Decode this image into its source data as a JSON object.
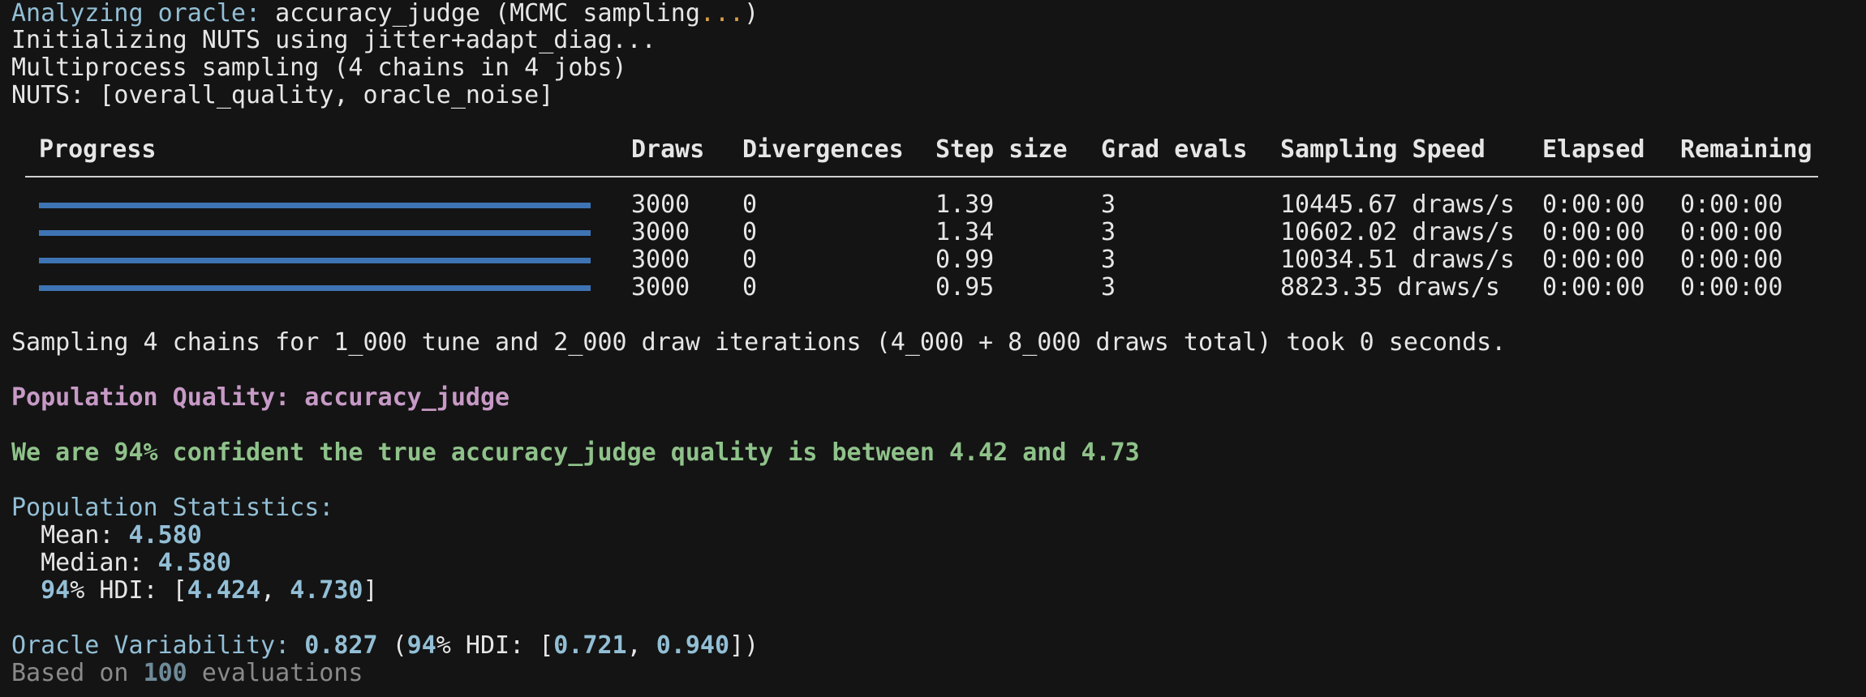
{
  "header": {
    "analyzing_label": "Analyzing oracle:",
    "oracle_name": "accuracy_judge",
    "method_open": "(MCMC sampling",
    "ellipsis": "...",
    "method_close": ")",
    "init_line": "Initializing NUTS using jitter+adapt_diag...",
    "multiprocess_line": "Multiprocess sampling (4 chains in 4 jobs)",
    "nuts_line": "NUTS: [overall_quality, oracle_noise]"
  },
  "table": {
    "columns": [
      "Progress",
      "Draws",
      "Divergences",
      "Step size",
      "Grad evals",
      "Sampling Speed",
      "Elapsed",
      "Remaining"
    ],
    "rows": [
      {
        "progress": 1.0,
        "draws": "3000",
        "divergences": "0",
        "step_size": "1.39",
        "grad_evals": "3",
        "speed": "10445.67 draws/s",
        "elapsed": "0:00:00",
        "remaining": "0:00:00"
      },
      {
        "progress": 1.0,
        "draws": "3000",
        "divergences": "0",
        "step_size": "1.34",
        "grad_evals": "3",
        "speed": "10602.02 draws/s",
        "elapsed": "0:00:00",
        "remaining": "0:00:00"
      },
      {
        "progress": 1.0,
        "draws": "3000",
        "divergences": "0",
        "step_size": "0.99",
        "grad_evals": "3",
        "speed": "10034.51 draws/s",
        "elapsed": "0:00:00",
        "remaining": "0:00:00"
      },
      {
        "progress": 1.0,
        "draws": "3000",
        "divergences": "0",
        "step_size": "0.95",
        "grad_evals": "3",
        "speed": "8823.35 draws/s",
        "elapsed": "0:00:00",
        "remaining": "0:00:00"
      }
    ],
    "bar_color": "#3e74b4"
  },
  "summary_line": "Sampling 4 chains for 1_000 tune and 2_000 draw iterations (4_000 + 8_000 draws total) took 0 seconds.",
  "population_quality": {
    "label": "Population Quality:",
    "name": "accuracy_judge"
  },
  "confidence_line": "We are 94% confident the true accuracy_judge quality is between 4.42 and 4.73",
  "stats": {
    "title": "Population Statistics:",
    "mean_label": "  Mean: ",
    "mean_value": "4.580",
    "median_label": "  Median: ",
    "median_value": "4.580",
    "hdi_indent": "  ",
    "hdi_pct": "94",
    "hdi_label": "% HDI: [",
    "hdi_low": "4.424",
    "hdi_sep": ", ",
    "hdi_high": "4.730",
    "hdi_close": "]"
  },
  "oracle_variability": {
    "label": "Oracle Variability: ",
    "value": "0.827",
    "open": " (",
    "pct": "94",
    "hdi_label": "% HDI: [",
    "low": "0.721",
    "sep": ", ",
    "high": "0.940",
    "close": "])"
  },
  "evaluations": {
    "prefix": "Based on ",
    "count": "100",
    "suffix": " evaluations"
  },
  "colors": {
    "background": "#141414",
    "cyan": "#93bfd6",
    "pink": "#c79ac6",
    "green": "#8fc28a",
    "orange": "#d7a04a",
    "gray": "#8a8a8a"
  }
}
